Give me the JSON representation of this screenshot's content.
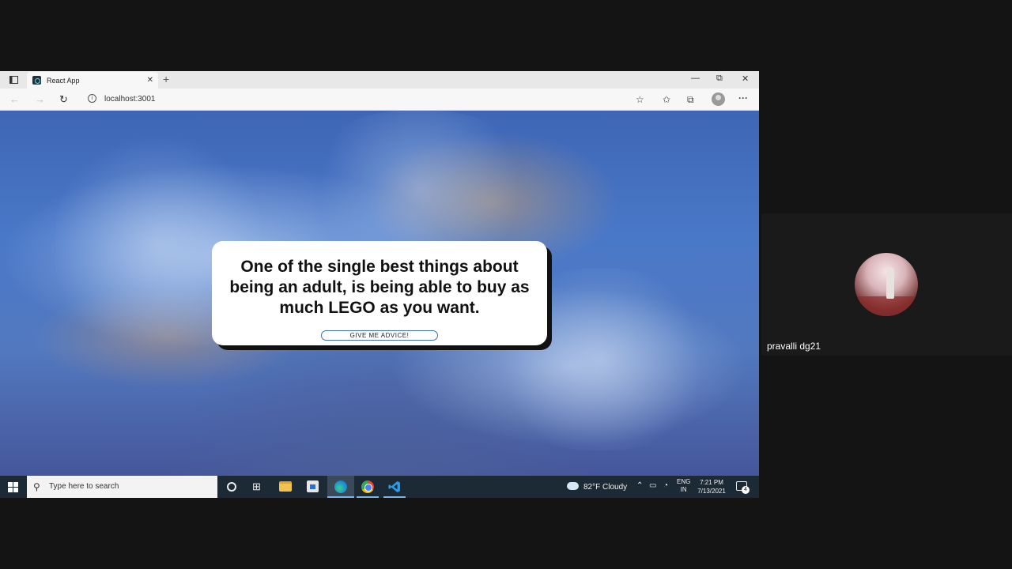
{
  "browser": {
    "tab_title": "React App",
    "tab_close": "✕",
    "new_tab": "+",
    "window_controls": {
      "minimize": "—",
      "restore": "⧉",
      "close": "✕"
    },
    "url": "localhost:3001"
  },
  "page": {
    "advice": "One of the single best things about being an adult, is being able to buy as much LEGO as you want.",
    "button_label": "GIVE ME ADVICE!"
  },
  "taskbar": {
    "search_placeholder": "Type here to search",
    "weather": "82°F  Cloudy",
    "lang_line1": "ENG",
    "lang_line2": "IN",
    "time": "7:21 PM",
    "date": "7/13/2021",
    "notification_count": "4"
  },
  "call": {
    "participant_name": "pravalli dg21"
  }
}
